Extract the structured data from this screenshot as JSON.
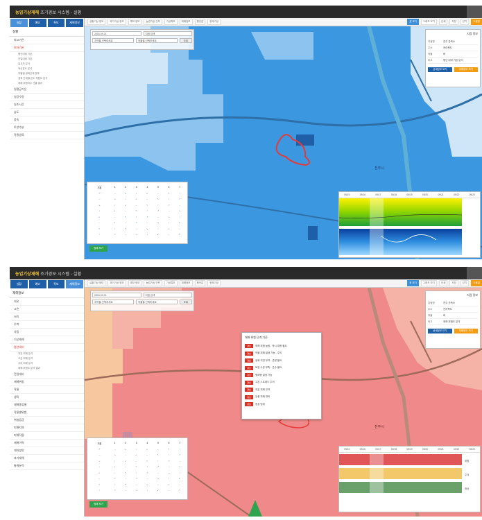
{
  "app": {
    "title_highlight": "농업기상재해",
    "title_rest": " 조기경보 시스템 - 실황"
  },
  "sidebar_tabs": [
    "실황",
    "예보",
    "특보",
    "재해정보"
  ],
  "shot1": {
    "sidebar": {
      "head": "실황",
      "items": [
        "최고기온",
        "최저기온",
        "일평균기온",
        "일강수량",
        "일조시간",
        "습도",
        "풍속",
        "토양수분",
        "작물생육"
      ],
      "subitems": [
        "평년대비 기온",
        "전일대비 기온",
        "일교차 분석",
        "적산온도 분석",
        "작물별 생육단계 분포",
        "생육 단계별 온도 적합도 분석",
        "재해 위험지수 산출 결과"
      ],
      "active_index": 1
    },
    "toolbar": {
      "left": [
        "실황기상 정보",
        "과거기상 정보",
        "예보 정보",
        "농업기상 관측",
        "기상특보",
        "재해정보",
        "평년값",
        "현재기상"
      ],
      "right": [
        "표 보기",
        "그래프 보기",
        "인쇄",
        "저장",
        "닫기",
        "도움말"
      ]
    },
    "filters": {
      "date": "2016.09.21",
      "time_button": "지점 검색",
      "select1": "지역을 선택하세요",
      "select2": "작물을 선택하세요",
      "go": "조회"
    },
    "info": {
      "title": "지점 정보",
      "rows": [
        {
          "k": "지점명",
          "v": "전주 관측소"
        },
        {
          "k": "주소",
          "v": "전라북도"
        },
        {
          "k": "작물",
          "v": "벼"
        },
        {
          "k": "비고",
          "v": "평년 대비 기온 분석"
        }
      ],
      "btn1": "상세정보 보기",
      "btn2": "재해정보 보기",
      "btn1_color": "#1f5fa8",
      "btn2_color": "#f39c12"
    },
    "legend": {
      "header": [
        "구분",
        "1",
        "2",
        "3",
        "4",
        "5",
        "6",
        "7"
      ],
      "button": "범례 보기"
    },
    "graph": {
      "header": [
        "09/15",
        "09/16",
        "09/17",
        "09/18",
        "09/19",
        "09/20",
        "09/21",
        "09/22",
        "09/23"
      ]
    },
    "map": {
      "place_label": "전주시",
      "colors": {
        "base": "#3b97e0",
        "light": "#8cc4ef",
        "pale": "#cfe6f8",
        "road": "#2f6fa8",
        "river": "#5fb0d8",
        "highlight": "#e6393a"
      }
    }
  },
  "shot2": {
    "sidebar": {
      "head": "재해정보",
      "items": [
        "저온",
        "고온",
        "서리",
        "우박",
        "가뭄",
        "기상재해",
        "평년대비",
        "전일대비",
        "재해위험",
        "작물",
        "생육",
        "재해종류별",
        "작물별위험",
        "위험등급",
        "피해지역",
        "피해작물",
        "재해이력",
        "대처방안",
        "과거재해",
        "통계분석"
      ],
      "subitems": [
        "저온 피해 분석",
        "고온 피해 분석",
        "서리 피해 분석",
        "재해 위험도 분석 결과"
      ],
      "active_index": 6
    },
    "toolbar": {
      "left": [
        "실황기상 정보",
        "과거기상 정보",
        "예보 정보",
        "농업기상 관측",
        "기상특보",
        "재해정보",
        "평년값",
        "현재기상"
      ],
      "right": [
        "표 보기",
        "그래프 보기",
        "인쇄",
        "저장",
        "닫기",
        "도움말"
      ]
    },
    "filters": {
      "date": "2016.09.21",
      "time_button": "지점 검색",
      "select1": "지역을 선택하세요",
      "select2": "작물을 선택하세요",
      "go": "조회"
    },
    "info": {
      "title": "지점 정보",
      "rows": [
        {
          "k": "지점명",
          "v": "전주 관측소"
        },
        {
          "k": "주소",
          "v": "전라북도"
        },
        {
          "k": "작물",
          "v": "벼"
        },
        {
          "k": "비고",
          "v": "재해 위험도 분석"
        }
      ],
      "btn1": "상세정보 보기",
      "btn2": "재해정보 보기",
      "btn1_color": "#1f5fa8",
      "btn2_color": "#f39c12"
    },
    "popup": {
      "title": "재해 위험 단계 기준",
      "badge": "경보",
      "items": [
        "재해 위험 높음 - 즉시 대응 필요",
        "작물 피해 발생 가능 - 주의",
        "생육 지연 우려 - 관찰 필요",
        "토양 수분 부족 - 관수 필요",
        "병해충 발생 가능",
        "고온 스트레스 주의",
        "저온 피해 우려",
        "강풍 피해 대비",
        "정상 범위"
      ]
    },
    "legend": {
      "header": [
        "구분",
        "1",
        "2",
        "3",
        "4",
        "5",
        "6",
        "7"
      ],
      "button": "범례 보기"
    },
    "graph": {
      "header": [
        "09/15",
        "09/16",
        "09/17",
        "09/18",
        "09/19",
        "09/20",
        "09/21",
        "09/22",
        "09/23"
      ],
      "right_labels": [
        "위험",
        "주의",
        "정상"
      ]
    },
    "map": {
      "place_label": "전주시",
      "colors": {
        "base": "#f08a8a",
        "pale": "#f7c8a0",
        "road": "#9e6a5a",
        "marker": "#2ea44f",
        "highlight": "#e6393a"
      }
    }
  }
}
